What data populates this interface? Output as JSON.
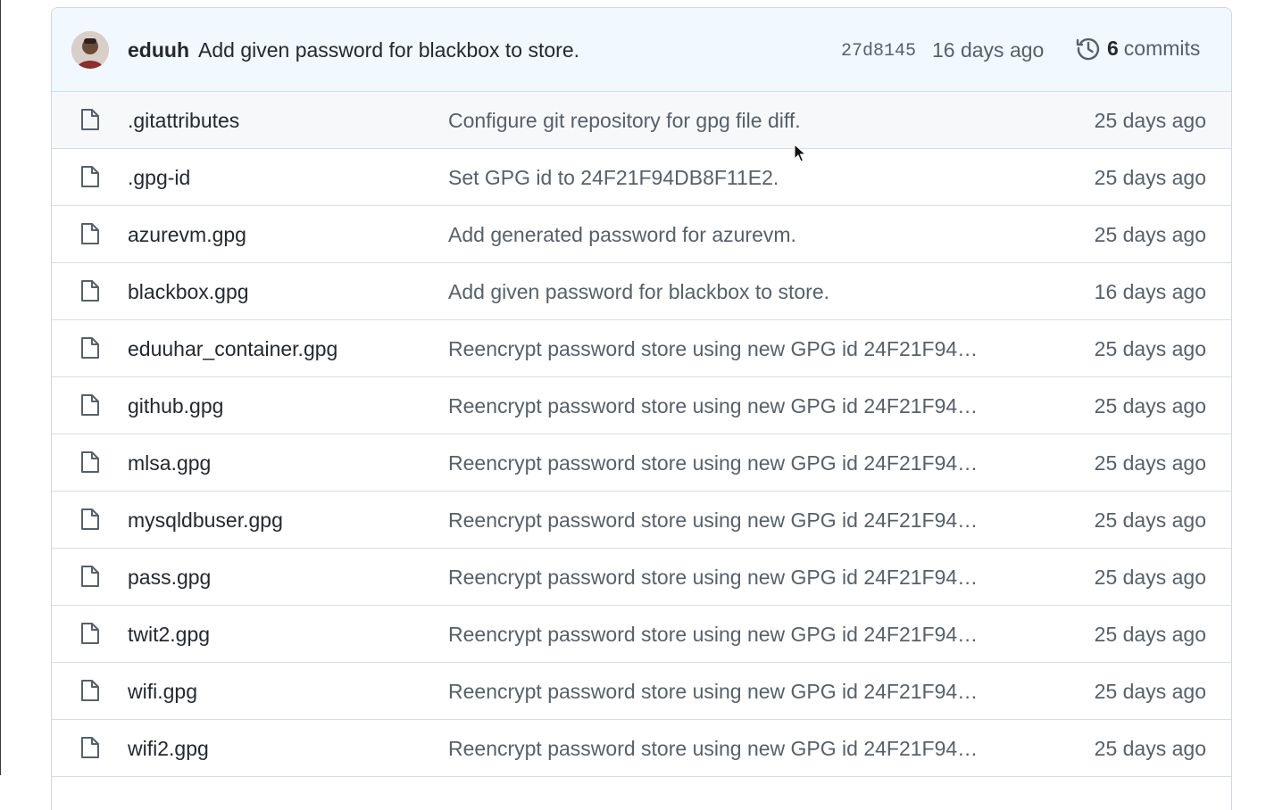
{
  "commit": {
    "author": "eduuh",
    "message": "Add given password for blackbox to store.",
    "sha": "27d8145",
    "age": "16 days ago",
    "commit_count": "6",
    "commits_label": "commits"
  },
  "files": [
    {
      "name": ".gitattributes",
      "commit": "Configure git repository for gpg file diff.",
      "age": "25 days ago"
    },
    {
      "name": ".gpg-id",
      "commit": "Set GPG id to 24F21F94DB8F11E2.",
      "age": "25 days ago"
    },
    {
      "name": "azurevm.gpg",
      "commit": "Add generated password for azurevm.",
      "age": "25 days ago"
    },
    {
      "name": "blackbox.gpg",
      "commit": "Add given password for blackbox to store.",
      "age": "16 days ago"
    },
    {
      "name": "eduuhar_container.gpg",
      "commit": "Reencrypt password store using new GPG id 24F21F94…",
      "age": "25 days ago"
    },
    {
      "name": "github.gpg",
      "commit": "Reencrypt password store using new GPG id 24F21F94…",
      "age": "25 days ago"
    },
    {
      "name": "mlsa.gpg",
      "commit": "Reencrypt password store using new GPG id 24F21F94…",
      "age": "25 days ago"
    },
    {
      "name": "mysqldbuser.gpg",
      "commit": "Reencrypt password store using new GPG id 24F21F94…",
      "age": "25 days ago"
    },
    {
      "name": "pass.gpg",
      "commit": "Reencrypt password store using new GPG id 24F21F94…",
      "age": "25 days ago"
    },
    {
      "name": "twit2.gpg",
      "commit": "Reencrypt password store using new GPG id 24F21F94…",
      "age": "25 days ago"
    },
    {
      "name": "wifi.gpg",
      "commit": "Reencrypt password store using new GPG id 24F21F94…",
      "age": "25 days ago"
    },
    {
      "name": "wifi2.gpg",
      "commit": "Reencrypt password store using new GPG id 24F21F94…",
      "age": "25 days ago"
    }
  ],
  "icons": {
    "file": "file-icon",
    "history": "history-icon",
    "avatar": "avatar"
  },
  "colors": {
    "header_bg": "#f1f8ff",
    "border": "#d0d7de",
    "muted_text": "#57606a",
    "text": "#24292f"
  }
}
